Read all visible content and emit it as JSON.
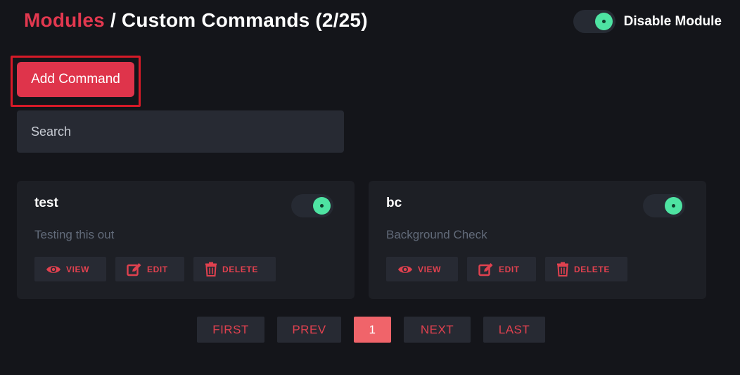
{
  "header": {
    "breadcrumb_link": "Modules",
    "separator": " / ",
    "title": "Custom Commands (2/25)"
  },
  "module_toggle": {
    "label": "Disable Module",
    "enabled": true
  },
  "add_button": {
    "label": "Add Command"
  },
  "search": {
    "placeholder": "Search"
  },
  "commands": [
    {
      "name": "test",
      "description": "Testing this out",
      "enabled": true,
      "actions": {
        "view": "VIEW",
        "edit": "EDIT",
        "delete": "DELETE"
      }
    },
    {
      "name": "bc",
      "description": "Background Check",
      "enabled": true,
      "actions": {
        "view": "VIEW",
        "edit": "EDIT",
        "delete": "DELETE"
      }
    }
  ],
  "pagination": {
    "first": "FIRST",
    "prev": "PREV",
    "current": "1",
    "next": "NEXT",
    "last": "LAST"
  },
  "colors": {
    "background": "#14151a",
    "accent": "#e2384f",
    "card": "#1d1f25",
    "toggle_on": "#4ee3a2",
    "current_page": "#f0646a"
  },
  "icons": {
    "view": "eye-icon",
    "edit": "edit-icon",
    "delete": "trash-icon"
  }
}
